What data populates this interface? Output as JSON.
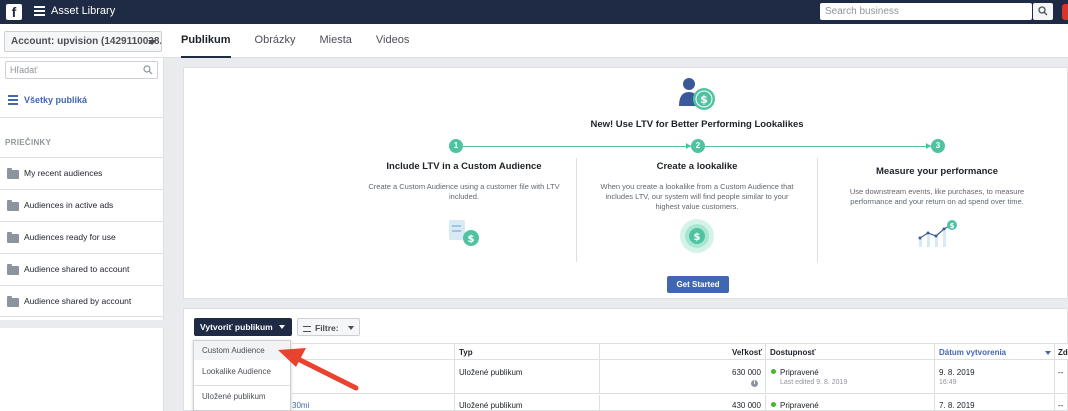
{
  "topbar": {
    "app_title": "Asset Library",
    "search_placeholder": "Search business"
  },
  "subbar": {
    "account_label": "Account: upvision (1429110028...",
    "tabs": [
      {
        "label": "Publikum",
        "active": true
      },
      {
        "label": "Obrázky",
        "active": false
      },
      {
        "label": "Miesta",
        "active": false
      },
      {
        "label": "Videos",
        "active": false
      }
    ]
  },
  "sidebar": {
    "search_placeholder": "Hľadať",
    "all_audiences": "Všetky publiká",
    "section_title": "PRIEČINKY",
    "folders": [
      "My recent audiences",
      "Audiences in active ads",
      "Audiences ready for use",
      "Audience shared to account",
      "Audience shared by account"
    ]
  },
  "promo": {
    "title": "New! Use LTV for Better Performing Lookalikes",
    "steps": [
      {
        "number": "1",
        "title": "Include LTV in a Custom Audience",
        "description": "Create a Custom Audience using a customer file with LTV included."
      },
      {
        "number": "2",
        "title": "Create a lookalike",
        "description": "When you create a lookalike from a Custom Audience that includes LTV, our system will find people similar to your highest value customers."
      },
      {
        "number": "3",
        "title": "Measure your performance",
        "description": "Use downstream events, like purchases, to measure performance and your return on ad spend over time."
      }
    ],
    "cta_label": "Get Started",
    "accent_color": "#4fc3a1"
  },
  "toolbar": {
    "create_label": "Vytvoriť publikum",
    "filter_label": "Filtre:"
  },
  "dropdown": {
    "items": [
      "Custom Audience",
      "Lookalike Audience",
      "Uložené publikum"
    ]
  },
  "table": {
    "headers": {
      "type": "Typ",
      "size": "Veľkosť",
      "availability": "Dostupnosť",
      "created": "Dátum vytvorenia",
      "extra": "Zd"
    },
    "rows": [
      {
        "name": "",
        "type": "Uložené publikum",
        "size": "630 000",
        "status": "Pripravené",
        "status_sub": "Last edited 9. 8. 2019",
        "date": "9. 8. 2019",
        "time": "16:49",
        "extra": "--"
      },
      {
        "name": "30mi",
        "type": "Uložené publikum",
        "size": "430 000",
        "status": "Pripravené",
        "status_sub": "",
        "date": "7. 8. 2019",
        "time": "",
        "extra": "--"
      }
    ]
  }
}
